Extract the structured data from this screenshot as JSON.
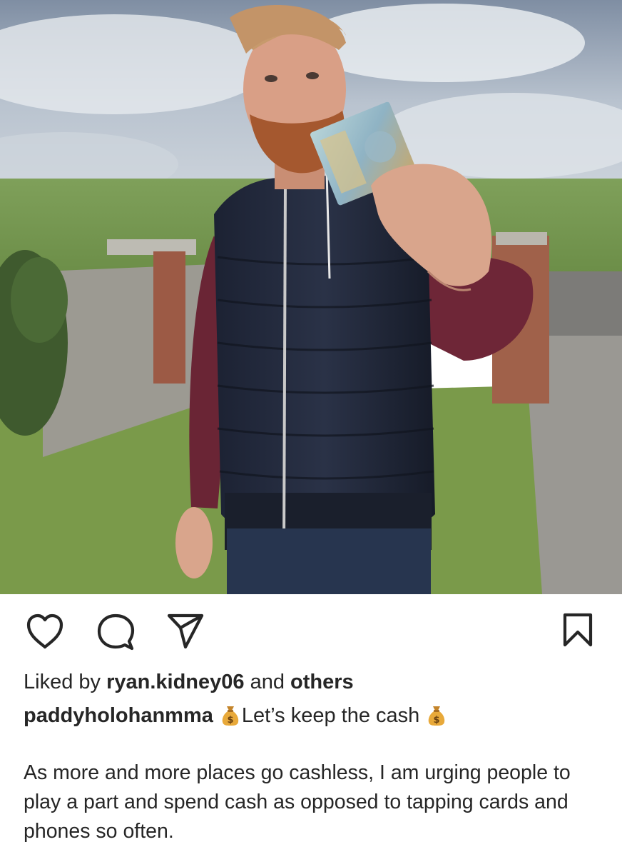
{
  "post": {
    "likes": {
      "prefix": "Liked by",
      "user": "ryan.kidney06",
      "middle": "and",
      "suffix": "others"
    },
    "caption": {
      "username": "paddyholohanmma",
      "text": "Let’s keep the cash",
      "emoji": "money-bag"
    },
    "body": "As more and more places go cashless,  I am urging people to play a part and spend cash as opposed to tapping cards and phones so often."
  },
  "icons": [
    "heart-icon",
    "comment-icon",
    "share-icon",
    "bookmark-icon",
    "money-bag-icon"
  ],
  "colors": {
    "text": "#262626",
    "icon": "#262626",
    "background": "#ffffff",
    "moneybag": "#e8a93a"
  }
}
